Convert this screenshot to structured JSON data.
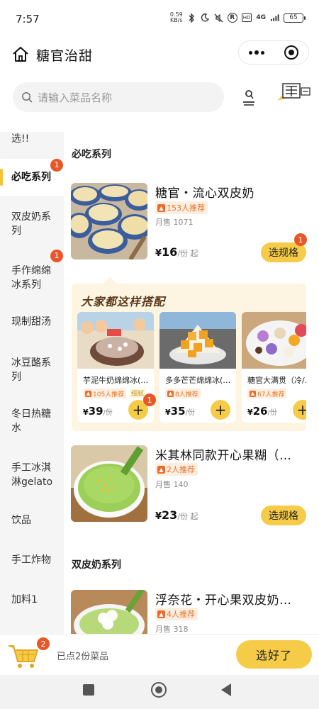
{
  "status": {
    "time": "7:57",
    "speed": "0.59\nKB/s",
    "network": "4G",
    "battery": "65"
  },
  "header": {
    "title": "糖官治甜"
  },
  "search": {
    "placeholder": "请输入菜品名称"
  },
  "sidebar": {
    "items": [
      {
        "label": "选!!"
      },
      {
        "label": "必吃系列",
        "badge": "1"
      },
      {
        "label": "双皮奶系列"
      },
      {
        "label": "手作绵绵冰系列",
        "badge": "1"
      },
      {
        "label": "现制甜汤"
      },
      {
        "label": "冰豆酪系列"
      },
      {
        "label": "冬日热糖水"
      },
      {
        "label": "手工冰淇淋gelato"
      },
      {
        "label": "饮品"
      },
      {
        "label": "手工炸物"
      },
      {
        "label": "加料1"
      }
    ]
  },
  "sections": [
    {
      "title": "必吃系列"
    },
    {
      "title": "双皮奶系列"
    }
  ],
  "products": [
    {
      "name": "糖官・流心双皮奶",
      "recommend": "153人推荐",
      "monthly": "月售 1071",
      "price": "16",
      "price_unit": "/份 起",
      "button": "选规格",
      "badge": "1"
    },
    {
      "name": "米其林同款开心果糊（…",
      "recommend": "2人推荐",
      "monthly": "月售 140",
      "price": "23",
      "price_unit": "/份 起",
      "button": "选规格"
    },
    {
      "name": "浮奈花・开心果双皮奶…",
      "recommend": "4人推荐",
      "monthly": "月售 318"
    }
  ],
  "combo": {
    "title": "大家都这样搭配",
    "items": [
      {
        "name": "芋泥牛奶绵绵冰(…",
        "recommend": "105人推荐",
        "tag": "细腻",
        "price": "39",
        "unit": "/份",
        "badge": "1"
      },
      {
        "name": "多多芒芒绵绵冰(…",
        "recommend": "8人推荐",
        "price": "35",
        "unit": "/份"
      },
      {
        "name": "糖官大满贯（冷/…",
        "recommend": "67人推荐",
        "price": "26",
        "unit": "/份"
      }
    ]
  },
  "cart": {
    "count": "2",
    "text": "已点2份菜品",
    "checkout": "选好了"
  },
  "colors": {
    "accent": "#f6cb48",
    "badge": "#e8572a",
    "recommend_text": "#e5762b",
    "combo_bg": "#fdf5e2"
  },
  "yen": "¥",
  "plus": "+"
}
